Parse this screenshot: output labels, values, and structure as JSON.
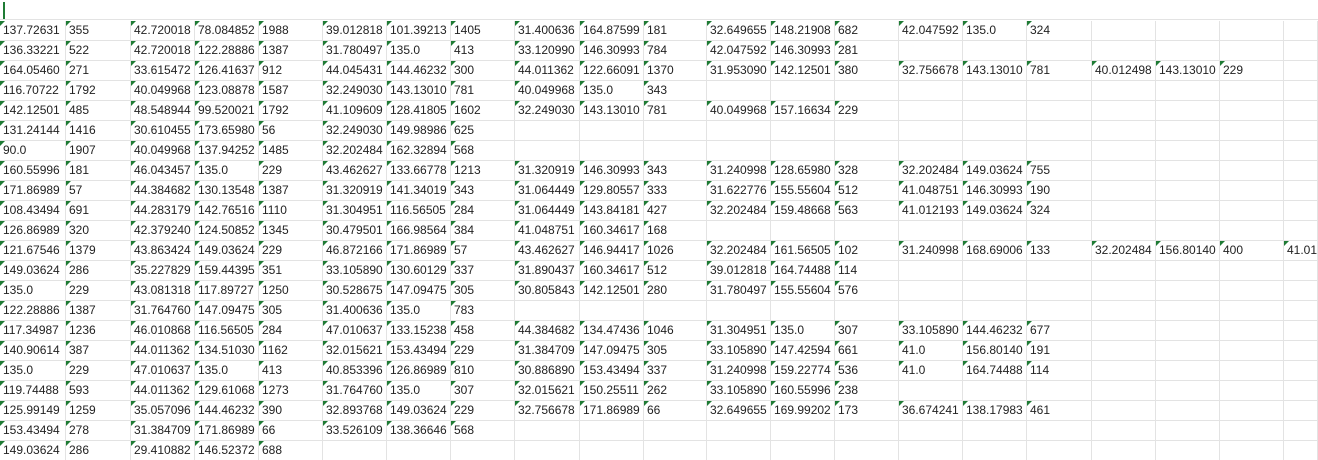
{
  "sheet": {
    "rows": [
      [
        "137.72631",
        "355",
        "42.720018",
        "78.084852",
        "1988",
        "39.012818",
        "101.39213",
        "1405",
        "31.400636",
        "164.87599",
        "181",
        "32.649655",
        "148.21908",
        "682",
        "42.047592",
        "135.0",
        "324"
      ],
      [
        "136.33221",
        "522",
        "42.720018",
        "122.28886",
        "1387",
        "31.780497",
        "135.0",
        "413",
        "33.120990",
        "146.30993",
        "784",
        "42.047592",
        "146.30993",
        "281"
      ],
      [
        "164.05460",
        "271",
        "33.615472",
        "126.41637",
        "912",
        "44.045431",
        "144.46232",
        "300",
        "44.011362",
        "122.66091",
        "1370",
        "31.953090",
        "142.12501",
        "380",
        "32.756678",
        "143.13010",
        "781",
        "40.012498",
        "143.13010",
        "229"
      ],
      [
        "116.70722",
        "1792",
        "40.049968",
        "123.08878",
        "1587",
        "32.249030",
        "143.13010",
        "781",
        "40.049968",
        "135.0",
        "343"
      ],
      [
        "142.12501",
        "485",
        "48.548944",
        "99.520021",
        "1792",
        "41.109609",
        "128.41805",
        "1602",
        "32.249030",
        "143.13010",
        "781",
        "40.049968",
        "157.16634",
        "229"
      ],
      [
        "131.24144",
        "1416",
        "30.610455",
        "173.65980",
        "56",
        "32.249030",
        "149.98986",
        "625"
      ],
      [
        "90.0",
        "1907",
        "40.049968",
        "137.94252",
        "1485",
        "32.202484",
        "162.32894",
        "568"
      ],
      [
        "160.55996",
        "181",
        "46.043457",
        "135.0",
        "229",
        "43.462627",
        "133.66778",
        "1213",
        "31.320919",
        "146.30993",
        "343",
        "31.240998",
        "128.65980",
        "328",
        "32.202484",
        "149.03624",
        "755"
      ],
      [
        "171.86989",
        "57",
        "44.384682",
        "130.13548",
        "1387",
        "31.320919",
        "141.34019",
        "343",
        "31.064449",
        "129.80557",
        "333",
        "31.622776",
        "155.55604",
        "512",
        "41.048751",
        "146.30993",
        "190"
      ],
      [
        "108.43494",
        "691",
        "44.283179",
        "142.76516",
        "1110",
        "31.304951",
        "116.56505",
        "284",
        "31.064449",
        "143.84181",
        "427",
        "32.202484",
        "159.48668",
        "563",
        "41.012193",
        "149.03624",
        "324"
      ],
      [
        "126.86989",
        "320",
        "42.379240",
        "124.50852",
        "1345",
        "30.479501",
        "166.98564",
        "384",
        "41.048751",
        "160.34617",
        "168"
      ],
      [
        "121.67546",
        "1379",
        "43.863424",
        "149.03624",
        "229",
        "46.872166",
        "171.86989",
        "57",
        "43.462627",
        "146.94417",
        "1026",
        "32.202484",
        "161.56505",
        "102",
        "31.240998",
        "168.69006",
        "133",
        "32.202484",
        "156.80140",
        "400",
        "41.01"
      ],
      [
        "149.03624",
        "286",
        "35.227829",
        "159.44395",
        "351",
        "33.105890",
        "130.60129",
        "337",
        "31.890437",
        "160.34617",
        "512",
        "39.012818",
        "164.74488",
        "114"
      ],
      [
        "135.0",
        "229",
        "43.081318",
        "117.89727",
        "1250",
        "30.528675",
        "147.09475",
        "305",
        "30.805843",
        "142.12501",
        "280",
        "31.780497",
        "155.55604",
        "576"
      ],
      [
        "122.28886",
        "1387",
        "31.764760",
        "147.09475",
        "305",
        "31.400636",
        "135.0",
        "783"
      ],
      [
        "117.34987",
        "1236",
        "46.010868",
        "116.56505",
        "284",
        "47.010637",
        "133.15238",
        "458",
        "44.384682",
        "134.47436",
        "1046",
        "31.304951",
        "135.0",
        "307",
        "33.105890",
        "144.46232",
        "677"
      ],
      [
        "140.90614",
        "387",
        "44.011362",
        "134.51030",
        "1162",
        "32.015621",
        "153.43494",
        "229",
        "31.384709",
        "147.09475",
        "305",
        "33.105890",
        "147.42594",
        "661",
        "41.0",
        "156.80140",
        "191"
      ],
      [
        "135.0",
        "229",
        "47.010637",
        "135.0",
        "413",
        "40.853396",
        "126.86989",
        "810",
        "30.886890",
        "153.43494",
        "337",
        "31.240998",
        "159.22774",
        "536",
        "41.0",
        "164.74488",
        "114"
      ],
      [
        "119.74488",
        "593",
        "44.011362",
        "129.61068",
        "1273",
        "31.764760",
        "135.0",
        "307",
        "32.015621",
        "150.25511",
        "262",
        "33.105890",
        "160.55996",
        "238"
      ],
      [
        "125.99149",
        "1259",
        "35.057096",
        "144.46232",
        "390",
        "32.893768",
        "149.03624",
        "229",
        "32.756678",
        "171.86989",
        "66",
        "32.649655",
        "169.99202",
        "173",
        "36.674241",
        "138.17983",
        "461"
      ],
      [
        "153.43494",
        "278",
        "31.384709",
        "171.86989",
        "66",
        "33.526109",
        "138.36646",
        "568"
      ],
      [
        "149.03624",
        "286",
        "29.410882",
        "146.52372",
        "688"
      ]
    ]
  }
}
